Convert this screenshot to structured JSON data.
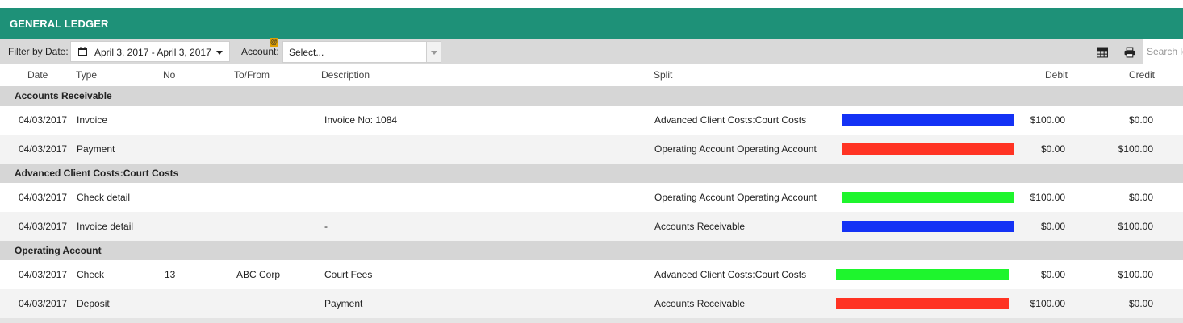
{
  "header": {
    "title": "GENERAL LEDGER"
  },
  "toolbar": {
    "filter_label": "Filter by Date:",
    "date_range": "April 3, 2017 - April 3, 2017",
    "account_label": "Account:",
    "account_placeholder": "Select...",
    "at_badge": "@",
    "search_placeholder": "Search ledger"
  },
  "columns": {
    "date": "Date",
    "type": "Type",
    "no": "No",
    "to_from": "To/From",
    "description": "Description",
    "split": "Split",
    "debit": "Debit",
    "credit": "Credit"
  },
  "groups": [
    {
      "name": "Accounts Receivable",
      "rows": [
        {
          "date": "04/03/2017",
          "type": "Invoice",
          "no": "",
          "to_from": "",
          "description": "Invoice No: 1084",
          "split": "Advanced Client Costs:Court Costs",
          "color": "#1432f5",
          "debit": "$100.00",
          "credit": "$0.00"
        },
        {
          "date": "04/03/2017",
          "type": "Payment",
          "no": "",
          "to_from": "",
          "description": "",
          "split": "Operating Account Operating Account",
          "color": "#ff3323",
          "debit": "$0.00",
          "credit": "$100.00"
        }
      ]
    },
    {
      "name": "Advanced Client Costs:Court Costs",
      "rows": [
        {
          "date": "04/03/2017",
          "type": "Check detail",
          "no": "",
          "to_from": "",
          "description": "",
          "split": "Operating Account Operating Account",
          "color": "#1ef52d",
          "debit": "$100.00",
          "credit": "$0.00"
        },
        {
          "date": "04/03/2017",
          "type": "Invoice detail",
          "no": "",
          "to_from": "",
          "description": "-",
          "split": "Accounts Receivable",
          "color": "#1432f5",
          "debit": "$0.00",
          "credit": "$100.00"
        }
      ]
    },
    {
      "name": "Operating Account",
      "rows": [
        {
          "date": "04/03/2017",
          "type": "Check",
          "no": "13",
          "to_from": "ABC Corp",
          "description": "Court Fees",
          "split": "Advanced Client Costs:Court Costs",
          "color": "#1ef52d",
          "debit": "$0.00",
          "credit": "$100.00"
        },
        {
          "date": "04/03/2017",
          "type": "Deposit",
          "no": "",
          "to_from": "",
          "description": "Payment",
          "split": "Accounts Receivable",
          "color": "#ff3323",
          "debit": "$100.00",
          "credit": "$0.00"
        }
      ]
    }
  ]
}
